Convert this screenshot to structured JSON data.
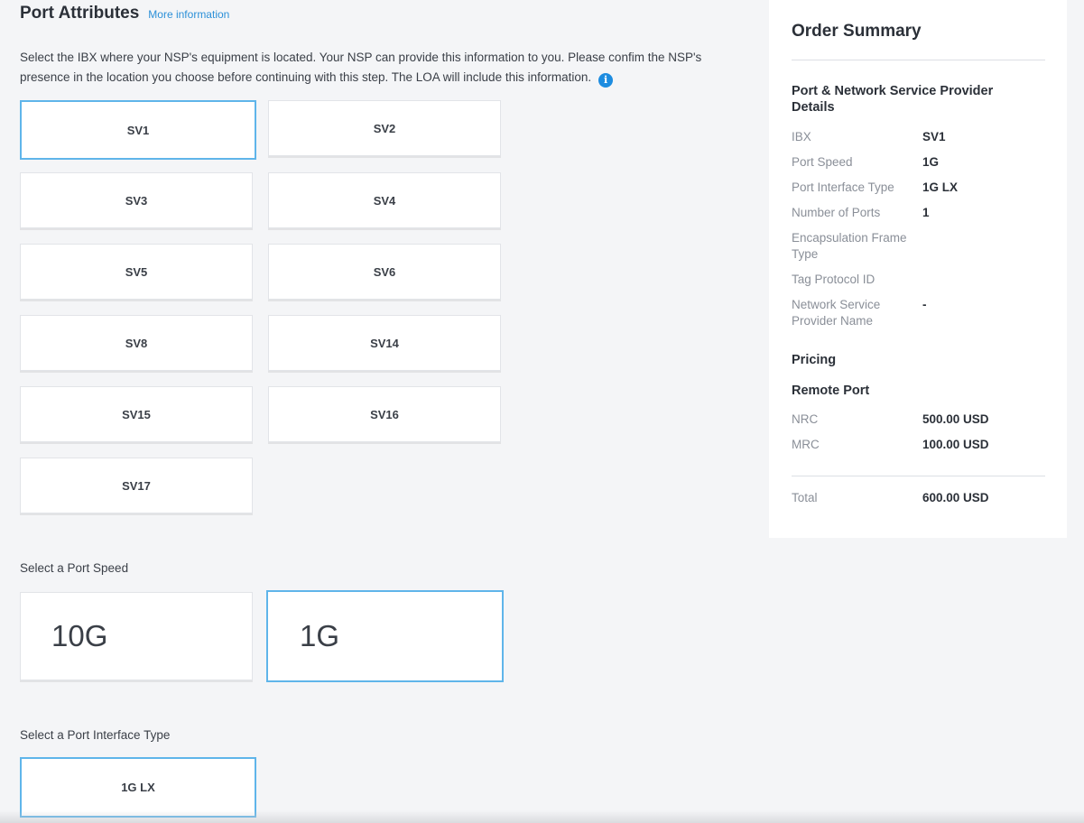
{
  "header": {
    "title": "Port Attributes",
    "more_info": "More information"
  },
  "description": "Select the IBX where your NSP's equipment is located. Your NSP can provide this information to you. Please confim the NSP's presence in the location you choose before continuing with this step. The LOA will include this information.",
  "info_icon": "info-icon",
  "ibx_options": [
    "SV1",
    "SV2",
    "SV3",
    "SV4",
    "SV5",
    "SV6",
    "SV8",
    "SV14",
    "SV15",
    "SV16",
    "SV17"
  ],
  "ibx_selected": "SV1",
  "port_speed": {
    "label": "Select a Port Speed",
    "options": [
      "10G",
      "1G"
    ],
    "selected": "1G"
  },
  "interface_type": {
    "label": "Select a Port Interface Type",
    "options": [
      "1G LX"
    ],
    "selected": "1G LX"
  },
  "summary": {
    "title": "Order Summary",
    "details_heading": "Port & Network Service Provider Details",
    "details": [
      {
        "key": "IBX",
        "value": "SV1"
      },
      {
        "key": "Port Speed",
        "value": "1G"
      },
      {
        "key": "Port Interface Type",
        "value": "1G LX"
      },
      {
        "key": "Number of Ports",
        "value": "1"
      },
      {
        "key": "Encapsulation Frame Type",
        "value": ""
      },
      {
        "key": "Tag Protocol ID",
        "value": ""
      },
      {
        "key": "Network Service Provider Name",
        "value": "-"
      }
    ],
    "pricing_heading": "Pricing",
    "remote_port_heading": "Remote Port",
    "pricing": [
      {
        "key": "NRC",
        "value": "500.00 USD"
      },
      {
        "key": "MRC",
        "value": "100.00 USD"
      }
    ],
    "total": {
      "key": "Total",
      "value": "600.00 USD"
    }
  },
  "colors": {
    "accent": "#5fb5ea",
    "link": "#2c90d8",
    "info": "#1d8ce0",
    "background": "#f4f5f7"
  }
}
